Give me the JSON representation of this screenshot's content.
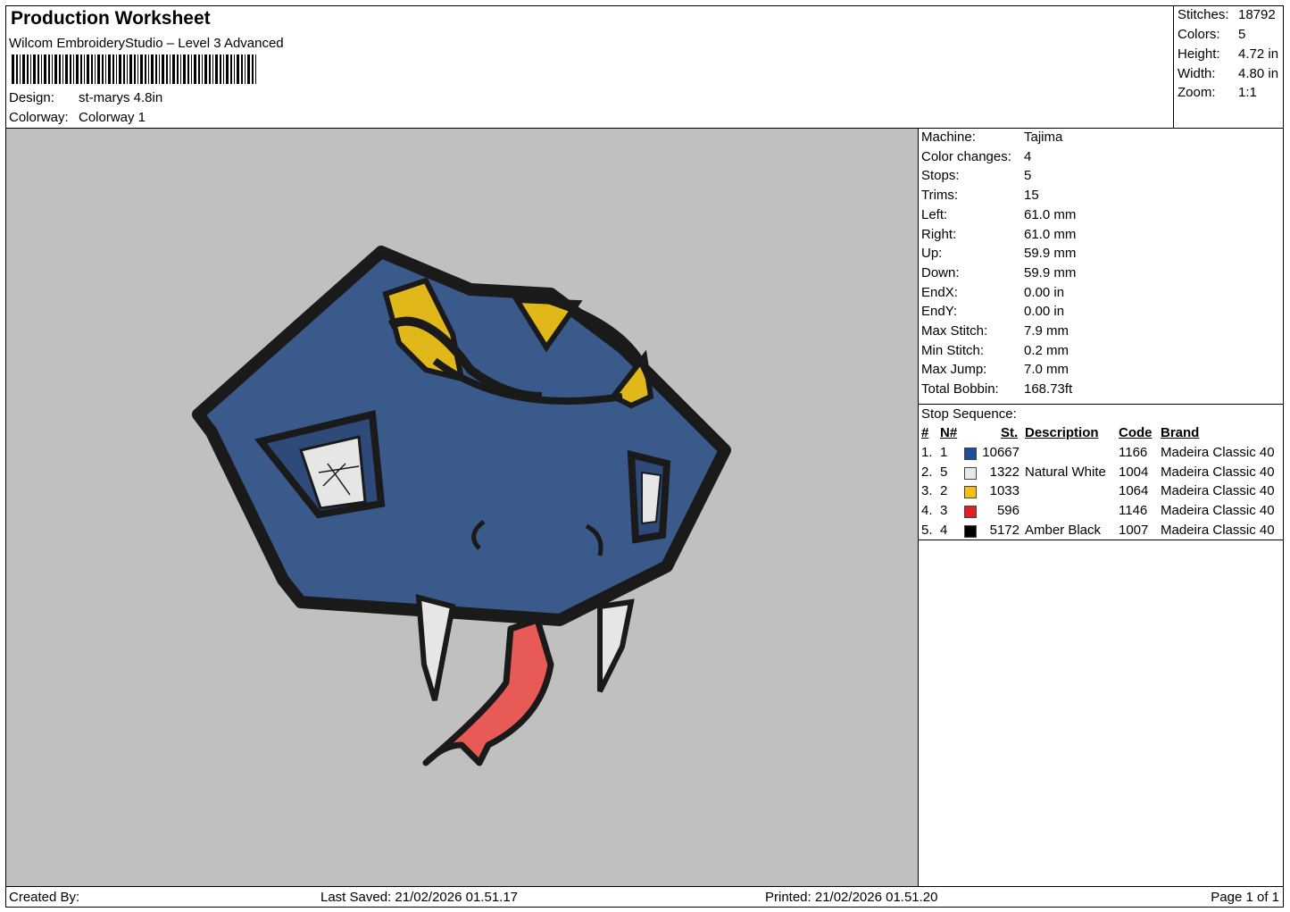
{
  "header": {
    "title": "Production Worksheet",
    "software": "Wilcom EmbroideryStudio – Level 3 Advanced",
    "design_label": "Design:",
    "design_value": "st-marys 4.8in",
    "colorway_label": "Colorway:",
    "colorway_value": "Colorway 1"
  },
  "stats": [
    {
      "label": "Stitches:",
      "value": "18792"
    },
    {
      "label": "Colors:",
      "value": "5"
    },
    {
      "label": "Height:",
      "value": "4.72 in"
    },
    {
      "label": "Width:",
      "value": "4.80 in"
    },
    {
      "label": "Zoom:",
      "value": "1:1"
    }
  ],
  "machine_info": [
    {
      "label": "Machine:",
      "value": "Tajima"
    },
    {
      "label": "Color changes:",
      "value": "4"
    },
    {
      "label": "Stops:",
      "value": "5"
    },
    {
      "label": "Trims:",
      "value": "15"
    },
    {
      "label": "Left:",
      "value": "61.0 mm"
    },
    {
      "label": "Right:",
      "value": "61.0 mm"
    },
    {
      "label": "Up:",
      "value": "59.9 mm"
    },
    {
      "label": "Down:",
      "value": "59.9 mm"
    },
    {
      "label": "EndX:",
      "value": "0.00 in"
    },
    {
      "label": "EndY:",
      "value": "0.00 in"
    },
    {
      "label": "Max Stitch:",
      "value": "7.9 mm"
    },
    {
      "label": "Min Stitch:",
      "value": "0.2 mm"
    },
    {
      "label": "Max Jump:",
      "value": "7.0 mm"
    },
    {
      "label": "Total Bobbin:",
      "value": "168.73ft"
    }
  ],
  "stop_sequence": {
    "title": "Stop Sequence:",
    "headers": {
      "num": "#",
      "n": "N#",
      "st": "St.",
      "description": "Description",
      "code": "Code",
      "brand": "Brand"
    },
    "rows": [
      {
        "num": "1.",
        "n": "1",
        "color": "#1f4e9a",
        "st": "10667",
        "description": "",
        "code": "1166",
        "brand": "Madeira Classic 40"
      },
      {
        "num": "2.",
        "n": "5",
        "color": "#e8e8e8",
        "st": "1322",
        "description": "Natural White",
        "code": "1004",
        "brand": "Madeira Classic 40"
      },
      {
        "num": "3.",
        "n": "2",
        "color": "#f3c010",
        "st": "1033",
        "description": "",
        "code": "1064",
        "brand": "Madeira Classic 40"
      },
      {
        "num": "4.",
        "n": "3",
        "color": "#e02020",
        "st": "596",
        "description": "",
        "code": "1146",
        "brand": "Madeira Classic 40"
      },
      {
        "num": "5.",
        "n": "4",
        "color": "#000000",
        "st": "5172",
        "description": "Amber Black",
        "code": "1007",
        "brand": "Madeira Classic 40"
      }
    ]
  },
  "footer": {
    "created_by": "Created By:",
    "last_saved": "Last Saved: 21/02/2026 01.51.17",
    "printed": "Printed: 21/02/2026 01.51.20",
    "page": "Page 1 of 1"
  },
  "design_colors": {
    "background": "#c0c0c0",
    "head": "#3a5a8c",
    "outline": "#1a1a1a",
    "eyes": "#e0b81a",
    "teeth": "#e6e6e6",
    "tongue": "#e85a55"
  }
}
